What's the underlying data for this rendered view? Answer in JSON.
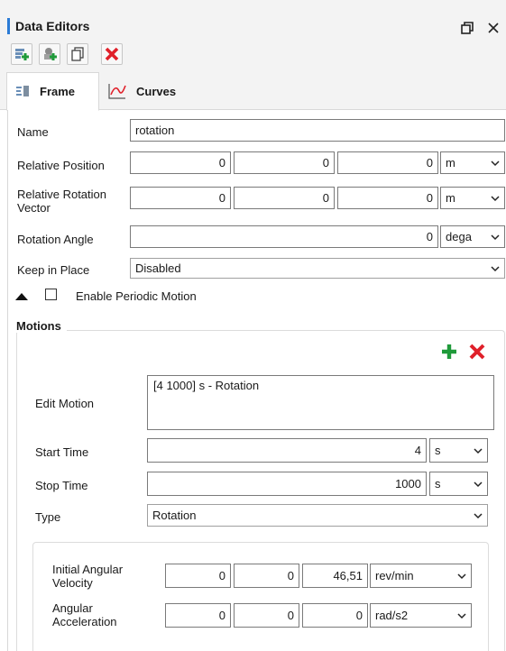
{
  "window": {
    "title": "Data Editors"
  },
  "tabs": [
    {
      "label": "Frame",
      "icon": "frame-icon",
      "active": true
    },
    {
      "label": "Curves",
      "icon": "curve-icon",
      "active": false
    }
  ],
  "toolbar": {
    "buttons": [
      {
        "icon": "add-frame-icon"
      },
      {
        "icon": "add-object-icon"
      },
      {
        "icon": "copy-icon"
      },
      {
        "icon": "delete-icon"
      }
    ]
  },
  "frame": {
    "name": {
      "label": "Name",
      "value": "rotation"
    },
    "relative_position": {
      "label": "Relative Position",
      "values": [
        "0",
        "0",
        "0"
      ],
      "unit": "m"
    },
    "relative_rotation_vector": {
      "label_line1": "Relative Rotation",
      "label_line2": "Vector",
      "values": [
        "0",
        "0",
        "0"
      ],
      "unit": "m"
    },
    "rotation_angle": {
      "label": "Rotation Angle",
      "value": "0",
      "unit": "dega"
    },
    "keep_in_place": {
      "label": "Keep in Place",
      "value": "Disabled"
    },
    "periodic_motion": {
      "label": "Enable Periodic Motion",
      "checked": false
    }
  },
  "motions": {
    "title": "Motions",
    "edit_motion": {
      "label": "Edit Motion",
      "value": "[4 1000] s - Rotation"
    },
    "start_time": {
      "label": "Start Time",
      "value": "4",
      "unit": "s"
    },
    "stop_time": {
      "label": "Stop Time",
      "value": "1000",
      "unit": "s"
    },
    "type": {
      "label": "Type",
      "value": "Rotation"
    },
    "initial_angular_velocity": {
      "label_line1": "Initial Angular",
      "label_line2": "Velocity",
      "values": [
        "0",
        "0",
        "46,51"
      ],
      "unit": "rev/min"
    },
    "angular_acceleration": {
      "label_line1": "Angular",
      "label_line2": "Acceleration",
      "values": [
        "0",
        "0",
        "0"
      ],
      "unit": "rad/s2"
    }
  },
  "colors": {
    "accent": "#2b7bd6",
    "add_green": "#1f9a3a",
    "delete_red": "#e0202a"
  }
}
